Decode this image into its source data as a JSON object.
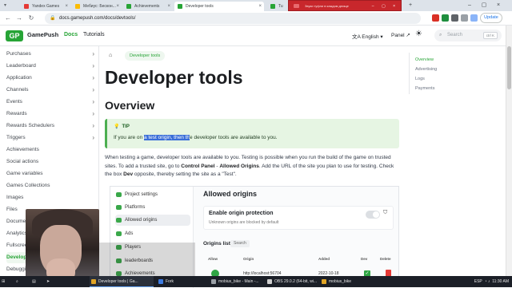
{
  "browser": {
    "tabs": [
      {
        "title": "Yandex Games",
        "favicon_color": "#e53935"
      },
      {
        "title": "Мебиус: Бескон...",
        "favicon_color": "#fbbc04"
      },
      {
        "title": "Achievements",
        "favicon_color": "#27a436"
      },
      {
        "title": "Developer tools",
        "favicon_color": "#27a436",
        "active": true
      },
      {
        "title": "Tu",
        "favicon_color": "#27a436"
      }
    ],
    "popup_text": "Звуки туфли в каждом днище",
    "url": "docs.gamepush.com/docs/devtools/",
    "update_label": "Update"
  },
  "site": {
    "brand": "GamePush",
    "logo_text": "GP",
    "nav_docs": "Docs",
    "nav_tutorials": "Tutorials",
    "language": "English",
    "panel": "Panel",
    "search_placeholder": "Search",
    "search_kbd": "ctrl K"
  },
  "sidebar": {
    "items": [
      {
        "label": "Purchases",
        "chevron": true
      },
      {
        "label": "Leaderboard",
        "chevron": true
      },
      {
        "label": "Application",
        "chevron": true
      },
      {
        "label": "Channels",
        "chevron": true
      },
      {
        "label": "Events",
        "chevron": true
      },
      {
        "label": "Rewards",
        "chevron": true
      },
      {
        "label": "Rewards Schedulers",
        "chevron": true
      },
      {
        "label": "Triggers",
        "chevron": true
      },
      {
        "label": "Achievements",
        "chevron": false
      },
      {
        "label": "Social actions",
        "chevron": false
      },
      {
        "label": "Game variables",
        "chevron": false
      },
      {
        "label": "Games Collections",
        "chevron": false
      },
      {
        "label": "Images",
        "chevron": false
      },
      {
        "label": "Files",
        "chevron": false
      },
      {
        "label": "Documents",
        "chevron": false
      },
      {
        "label": "Analytics",
        "chevron": false
      },
      {
        "label": "Fullscreen",
        "chevron": false
      },
      {
        "label": "Developer",
        "chevron": false,
        "active": true
      },
      {
        "label": "Debugging",
        "chevron": false
      }
    ]
  },
  "toc": {
    "items": [
      "Overview",
      "Advertising",
      "Logs",
      "Payments"
    ]
  },
  "main": {
    "breadcrumb": "Developer tools",
    "title": "Developer tools",
    "section": "Overview",
    "tip_label": "TIP",
    "tip_pre": "If you are on ",
    "tip_selected": "a test origin, then th",
    "tip_post": "e developer tools are available to you.",
    "para_1": "When testing a game, developer tools are available to you. Testing is possible when you run the build of the game on trusted sites. To add a trusted site, go to ",
    "para_b1": "Control Panel",
    "para_sep": " - ",
    "para_b2": "Allowed Origins",
    "para_2": ". Add the URL of the site you plan to use for testing. Check the box ",
    "para_b3": "Dev",
    "para_3": " opposite, thereby setting the site as a \"Test\"."
  },
  "screenshot": {
    "side_items": [
      "Project settings",
      "Platforms",
      "Allowed origins",
      "Ads",
      "Players",
      "leaderboards",
      "Achievements"
    ],
    "active_index": 2,
    "title": "Allowed origins",
    "card_title": "Enable origin protection",
    "card_sub": "Unknown origins are blocked by default",
    "origins_list": "Origins list",
    "search": "Search",
    "headers": [
      "Allow",
      "Origin",
      "Added",
      "Dev",
      "Delete"
    ],
    "row": {
      "origin": "http://localhost:56704",
      "added": "2022-10-18"
    }
  },
  "taskbar": {
    "items": [
      {
        "label": "Developer tools | Ga...",
        "color": "#e0a526",
        "active": true
      },
      {
        "label": "Fork",
        "color": "#3d7be0"
      },
      {
        "label": "mobius_bike - Main -...",
        "color": "#9aa0a6"
      },
      {
        "label": "OBS 29.0.2 (64-bit, wi...",
        "color": "#cfcfcf"
      },
      {
        "label": "mobius_bike",
        "color": "#e0a526"
      }
    ],
    "lang": "ESP",
    "time": "11:30 AM"
  }
}
